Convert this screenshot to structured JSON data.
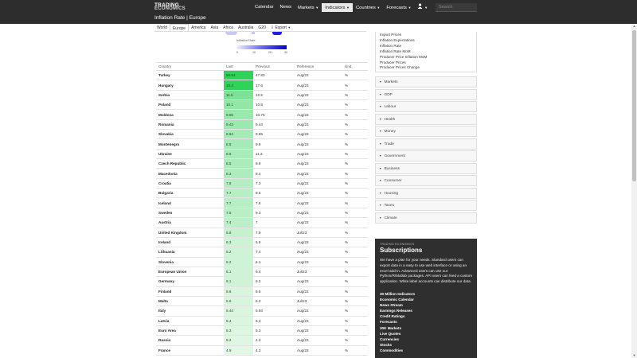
{
  "header": {
    "logo_line1": "TRADING",
    "logo_line2": "ECONOMICS",
    "page_title": "Inflation Rate | Europe",
    "nav": [
      "Calendar",
      "News",
      "Markets",
      "Indicators",
      "Countries",
      "Forecasts"
    ],
    "active_nav": "Indicators",
    "search_placeholder": "Search"
  },
  "region_tabs": [
    "World",
    "Europe",
    "America",
    "Asia",
    "Africa",
    "Australia",
    "G20"
  ],
  "active_tab": "Europe",
  "export_label": "Export",
  "legend": {
    "title": "Inflation Rate",
    "ticks": [
      "0",
      "10",
      "20",
      "30"
    ]
  },
  "table": {
    "headers": [
      "Country",
      "Last",
      "Previous",
      "Reference",
      "Unit"
    ],
    "rows": [
      {
        "country": "Turkey",
        "last": "58.94",
        "previous": "47.83",
        "reference": "Aug/23",
        "unit": "%"
      },
      {
        "country": "Hungary",
        "last": "16.4",
        "previous": "17.6",
        "reference": "Aug/23",
        "unit": "%"
      },
      {
        "country": "Serbia",
        "last": "11.5",
        "previous": "12.5",
        "reference": "Aug/23",
        "unit": "%"
      },
      {
        "country": "Poland",
        "last": "10.1",
        "previous": "10.8",
        "reference": "Aug/23",
        "unit": "%"
      },
      {
        "country": "Moldova",
        "last": "9.65",
        "previous": "10.76",
        "reference": "Aug/23",
        "unit": "%"
      },
      {
        "country": "Romania",
        "last": "9.43",
        "previous": "9.44",
        "reference": "Aug/23",
        "unit": "%"
      },
      {
        "country": "Slovakia",
        "last": "8.84",
        "previous": "9.65",
        "reference": "Aug/23",
        "unit": "%"
      },
      {
        "country": "Montenegro",
        "last": "8.8",
        "previous": "9.9",
        "reference": "Aug/23",
        "unit": "%"
      },
      {
        "country": "Ukraine",
        "last": "8.6",
        "previous": "11.3",
        "reference": "Aug/23",
        "unit": "%"
      },
      {
        "country": "Czech Republic",
        "last": "8.5",
        "previous": "8.8",
        "reference": "Aug/23",
        "unit": "%"
      },
      {
        "country": "Macedonia",
        "last": "8.3",
        "previous": "8.4",
        "reference": "Aug/23",
        "unit": "%"
      },
      {
        "country": "Croatia",
        "last": "7.8",
        "previous": "7.3",
        "reference": "Aug/23",
        "unit": "%"
      },
      {
        "country": "Bulgaria",
        "last": "7.7",
        "previous": "8.5",
        "reference": "Aug/23",
        "unit": "%"
      },
      {
        "country": "Iceland",
        "last": "7.7",
        "previous": "7.6",
        "reference": "Aug/23",
        "unit": "%"
      },
      {
        "country": "Sweden",
        "last": "7.5",
        "previous": "9.3",
        "reference": "Aug/23",
        "unit": "%"
      },
      {
        "country": "Austria",
        "last": "7.4",
        "previous": "7",
        "reference": "Aug/23",
        "unit": "%"
      },
      {
        "country": "United Kingdom",
        "last": "6.8",
        "previous": "7.9",
        "reference": "Jul/23",
        "unit": "%"
      },
      {
        "country": "Ireland",
        "last": "6.3",
        "previous": "5.8",
        "reference": "Aug/23",
        "unit": "%"
      },
      {
        "country": "Lithuania",
        "last": "6.2",
        "previous": "7.4",
        "reference": "Aug/23",
        "unit": "%"
      },
      {
        "country": "Slovenia",
        "last": "6.2",
        "previous": "6.1",
        "reference": "Aug/23",
        "unit": "%"
      },
      {
        "country": "European Union",
        "last": "6.1",
        "previous": "6.4",
        "reference": "Jul/23",
        "unit": "%"
      },
      {
        "country": "Germany",
        "last": "6.1",
        "previous": "6.2",
        "reference": "Aug/23",
        "unit": "%"
      },
      {
        "country": "Finland",
        "last": "5.6",
        "previous": "6.5",
        "reference": "Aug/23",
        "unit": "%"
      },
      {
        "country": "Malta",
        "last": "5.6",
        "previous": "6.2",
        "reference": "Jul/23",
        "unit": "%"
      },
      {
        "country": "Italy",
        "last": "5.44",
        "previous": "5.93",
        "reference": "Aug/23",
        "unit": "%"
      },
      {
        "country": "Latvia",
        "last": "5.4",
        "previous": "6.4",
        "reference": "Aug/23",
        "unit": "%"
      },
      {
        "country": "Euro Area",
        "last": "5.3",
        "previous": "5.3",
        "reference": "Aug/23",
        "unit": "%"
      },
      {
        "country": "Russia",
        "last": "5.2",
        "previous": "4.3",
        "reference": "Aug/23",
        "unit": "%"
      },
      {
        "country": "France",
        "last": "4.9",
        "previous": "4.3",
        "reference": "Aug/23",
        "unit": "%"
      }
    ]
  },
  "sidebar": {
    "indicators": [
      "Import Prices",
      "Inflation Expectations",
      "Inflation Rate",
      "Inflation Rate MoM",
      "Producer Price Inflation MoM",
      "Producer Prices",
      "Producer Prices Change"
    ],
    "categories": [
      "Markets",
      "GDP",
      "Labour",
      "Health",
      "Money",
      "Trade",
      "Government",
      "Business",
      "Consumer",
      "Housing",
      "Taxes",
      "Climate"
    ]
  },
  "subscriptions": {
    "brand": "TRADING ECONOMICS",
    "title": "Subscriptions",
    "text": "We have a plan for your needs. Standard users can export data in a easy to use web interface or using an excel add-in. Advanced users can use our Python/R/Matlab packages. API users can feed a custom application. White label accounts can distribute our data.",
    "features": [
      "30 Million Indicators",
      "Economic Calendar",
      "News Stream",
      "Earnings Releases",
      "Credit Ratings",
      "Forecasts",
      "30K Markets",
      "Live Quotes",
      "Currencies",
      "Stocks",
      "Commodities"
    ]
  },
  "colors": {
    "header_bg": "#2d2d2d",
    "green_high": "#2fd35a",
    "green_low": "#e3f7e6",
    "sub_bg": "#2f2f2f"
  }
}
